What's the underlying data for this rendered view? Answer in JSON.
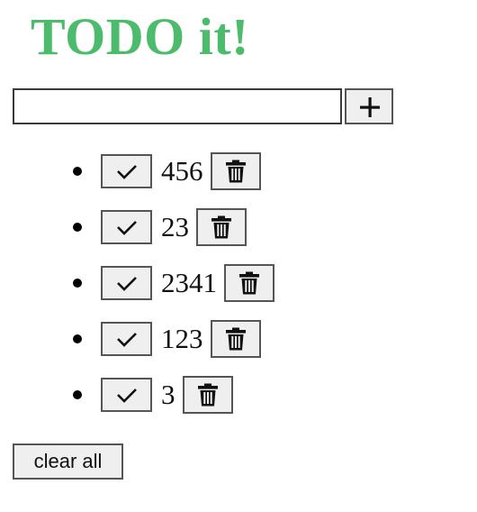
{
  "app": {
    "title": "TODO it!",
    "title_color": "#4cbb6b"
  },
  "add_form": {
    "input_value": "",
    "add_icon": "plus-icon"
  },
  "todos": [
    {
      "text": "456",
      "check_icon": "check-icon",
      "delete_icon": "trash-icon"
    },
    {
      "text": "23",
      "check_icon": "check-icon",
      "delete_icon": "trash-icon"
    },
    {
      "text": "2341",
      "check_icon": "check-icon",
      "delete_icon": "trash-icon"
    },
    {
      "text": "123",
      "check_icon": "check-icon",
      "delete_icon": "trash-icon"
    },
    {
      "text": "3",
      "check_icon": "check-icon",
      "delete_icon": "trash-icon"
    }
  ],
  "footer": {
    "clear_label": "clear all"
  }
}
